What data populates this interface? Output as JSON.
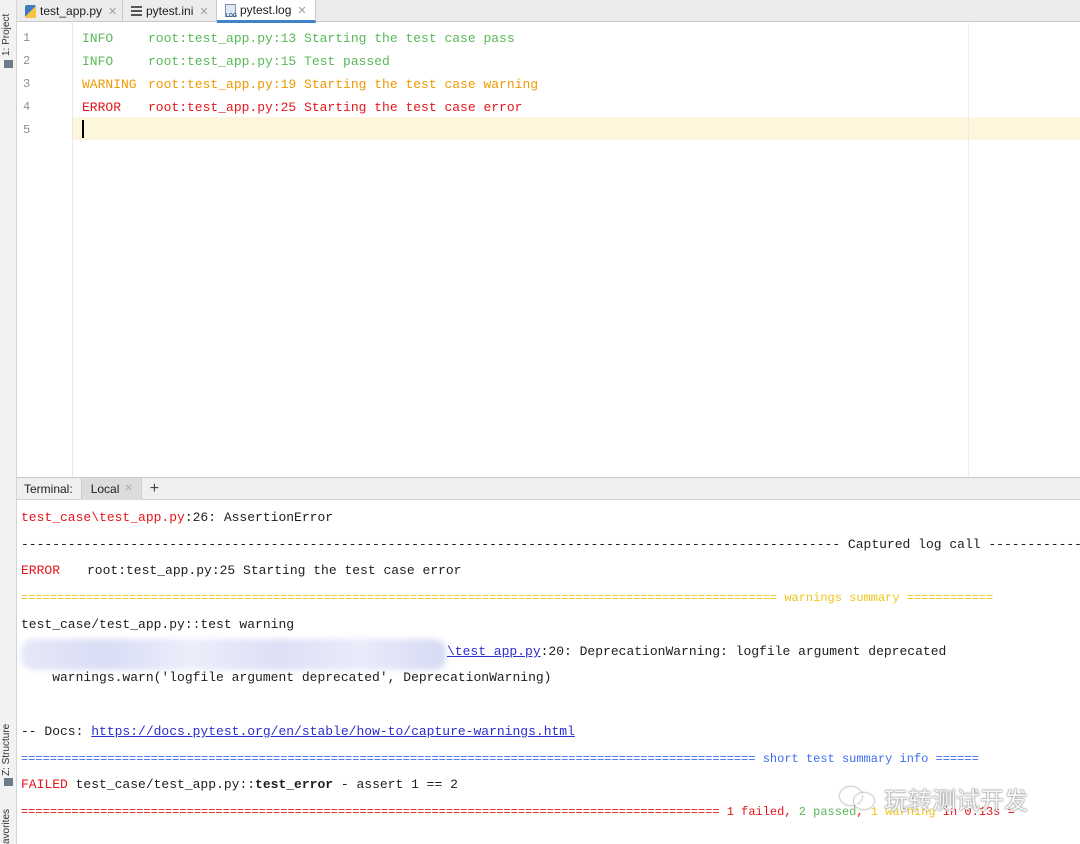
{
  "side_panel": {
    "project_label": "1: Project",
    "structure_label": "Z: Structure",
    "favorites_label": "avorites"
  },
  "tabs": [
    {
      "label": "test_app.py",
      "icon": "python-file-icon",
      "active": false
    },
    {
      "label": "pytest.ini",
      "icon": "ini-file-icon",
      "active": false
    },
    {
      "label": "pytest.log",
      "icon": "log-file-icon",
      "active": true
    }
  ],
  "editor": {
    "line_numbers": [
      "1",
      "2",
      "3",
      "4",
      "5"
    ],
    "lines": [
      {
        "level": "INFO",
        "message": "root:test_app.py:13 Starting the test case pass",
        "color": "#58b858"
      },
      {
        "level": "INFO",
        "message": "root:test_app.py:15 Test passed",
        "color": "#58b858"
      },
      {
        "level": "WARNING",
        "message": "root:test_app.py:19 Starting the test case warning",
        "color": "#ee9a00"
      },
      {
        "level": "ERROR",
        "message": "root:test_app.py:25 Starting the test case error",
        "color": "#e5151b"
      }
    ]
  },
  "terminal": {
    "title": "Terminal:",
    "tab_label": "Local",
    "add_label": "+",
    "assertion_path": "test_case\\test_app.py",
    "assertion_rest": ":26: AssertionError",
    "captured_rule": "--------------------------------------------------------------------------------------------------------- Captured log call ------------",
    "error_level": "ERROR",
    "error_message": "root:test_app.py:25 Starting the test case error",
    "warnings_rule": "========================================================================================================= warnings summary ============",
    "warning_test": "test_case/test_app.py::test warning",
    "warning_link": "\\test_app.py",
    "warning_line": ":20: DeprecationWarning: logfile argument deprecated",
    "warn_call": "    warnings.warn('logfile argument deprecated', DeprecationWarning)",
    "docs_prefix": "-- Docs: ",
    "docs_url": "https://docs.pytest.org/en/stable/how-to/capture-warnings.html",
    "summary_rule_left": "======================================================================================================",
    "summary_rule_text": " short test summary info ======",
    "failed_label": "FAILED",
    "failed_path": " test_case/test_app.py::",
    "failed_func": "test_error",
    "failed_rest": " - assert 1 == 2",
    "final_rule_left": "================================================================================================= ",
    "final_failed": "1 failed",
    "final_comma": ", ",
    "final_passed": "2 passed",
    "final_comma2": ", ",
    "final_warning": "1 warning",
    "final_time": " in 0.13s ="
  },
  "watermark": {
    "text": "玩转测试开发",
    "icon": "wechat-icon"
  }
}
